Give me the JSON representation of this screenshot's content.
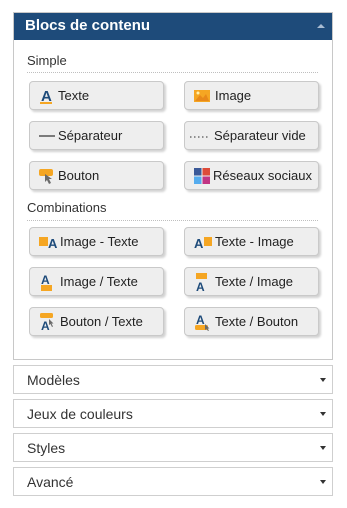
{
  "panel": {
    "title": "Blocs de contenu",
    "sections": {
      "simple": {
        "label": "Simple",
        "items": [
          {
            "label": "Texte",
            "icon": "text-a-icon"
          },
          {
            "label": "Image",
            "icon": "image-icon"
          },
          {
            "label": "Séparateur",
            "icon": "separator-line-icon"
          },
          {
            "label": "Séparateur vide",
            "icon": "empty-separator-icon"
          },
          {
            "label": "Bouton",
            "icon": "button-hand-icon"
          },
          {
            "label": "Réseaux sociaux",
            "icon": "social-networks-icon"
          }
        ]
      },
      "combinations": {
        "label": "Combinations",
        "items": [
          {
            "label": "Image - Texte",
            "icon": "image-text-icon"
          },
          {
            "label": "Texte - Image",
            "icon": "text-image-icon"
          },
          {
            "label": "Image / Texte",
            "icon": "image-over-text-icon"
          },
          {
            "label": "Texte / Image",
            "icon": "text-over-image-icon"
          },
          {
            "label": "Bouton / Texte",
            "icon": "button-over-text-icon"
          },
          {
            "label": "Texte / Bouton",
            "icon": "text-over-button-icon"
          }
        ]
      }
    }
  },
  "accordion": [
    {
      "label": "Modèles"
    },
    {
      "label": "Jeux de couleurs"
    },
    {
      "label": "Styles"
    },
    {
      "label": "Avancé"
    }
  ],
  "colors": {
    "header_bg": "#1e4b7a",
    "text_icon": "#1e4b7a",
    "image_icon": "#f5a623"
  }
}
